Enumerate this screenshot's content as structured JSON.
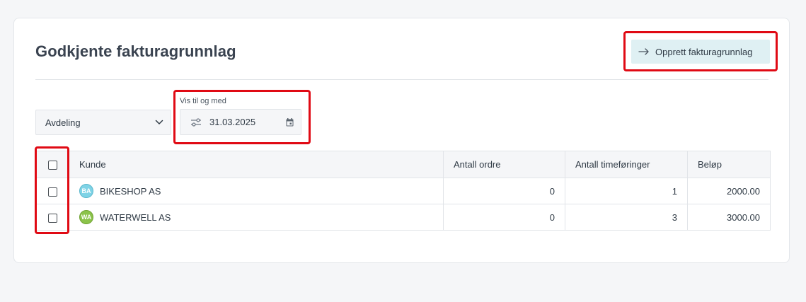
{
  "page": {
    "title": "Godkjente fakturagrunnlag",
    "create_button_label": "Opprett fakturagrunnlag"
  },
  "filters": {
    "department_value": "Avdeling",
    "date_label": "Vis til og med",
    "date_value": "31.03.2025"
  },
  "table": {
    "columns": [
      "Kunde",
      "Antall ordre",
      "Antall timeføringer",
      "Beløp"
    ],
    "rows": [
      {
        "initials": "BA",
        "avatar_bg": "#7fd3e6",
        "avatar_border": "#5ab7cc",
        "customer": "BIKESHOP AS",
        "orders": "0",
        "time_entries": "1",
        "amount": "2000.00"
      },
      {
        "initials": "WA",
        "avatar_bg": "#8bc34a",
        "avatar_border": "#6fa231",
        "customer": "WATERWELL AS",
        "orders": "0",
        "time_entries": "3",
        "amount": "3000.00"
      }
    ]
  },
  "colors": {
    "highlight": "#e00a14",
    "button_bg": "#dff0f3"
  }
}
